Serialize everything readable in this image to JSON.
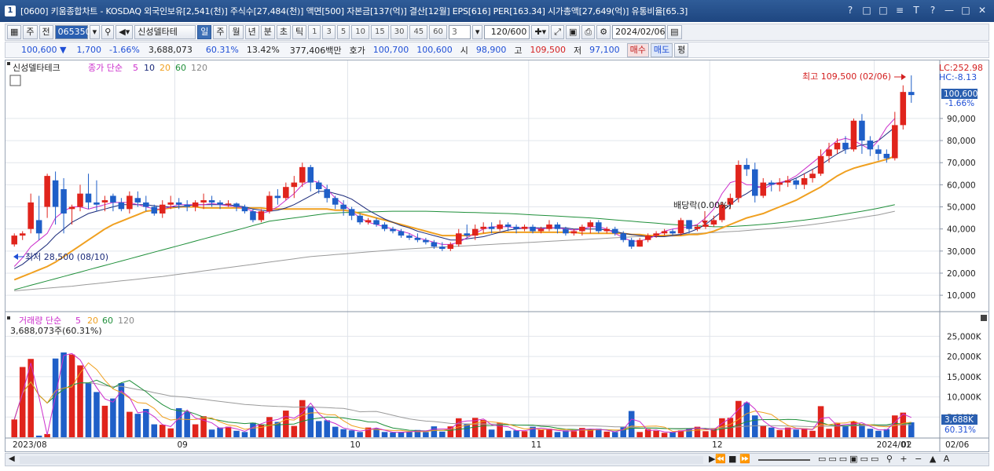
{
  "window": {
    "title": "[0600] 키움종합차트 - KOSDAQ 외국인보유[2,541(천)] 주식수[27,484(천)] 액면[500] 자본금[137(억)] 결산[12월] EPS[616] PER[163.34] 시가총액[27,649(억)] 유통비율[65.3]",
    "badge": "1",
    "buttons": [
      "?",
      "□",
      "□",
      "≡",
      "T",
      "?",
      "—",
      "□",
      "✕"
    ]
  },
  "toolbar": {
    "period_type": "주",
    "prev": "전",
    "code": "065350",
    "name": "신성델타테",
    "periods": [
      "일",
      "주",
      "월",
      "년",
      "분",
      "초",
      "틱"
    ],
    "minutes": [
      "1",
      "3",
      "5",
      "10",
      "15",
      "30",
      "45",
      "60"
    ],
    "custom_min": "3",
    "count": "120/600",
    "date": "2024/02/06"
  },
  "quote": {
    "price": "100,600",
    "arrow": "▼",
    "change": "1,700",
    "rate": "-1.66%",
    "volume": "3,688,073",
    "vol_rate": "60.31%",
    "turnover": "13.42%",
    "amount": "377,406백만",
    "ask_label": "호가",
    "ask": "100,700",
    "bid": "100,600",
    "open_label": "시",
    "open": "98,900",
    "high_label": "고",
    "high": "109,500",
    "low_label": "저",
    "low": "97,100",
    "buy": "매수",
    "sell": "매도",
    "even": "평"
  },
  "price_panel": {
    "name": "신성델타테크",
    "legend_prefix": "종가 단순",
    "mas": [
      "5",
      "10",
      "20",
      "60",
      "120"
    ],
    "ma_colors": [
      "#cc2fcc",
      "#1b2a7a",
      "#f0a020",
      "#1f8f3a",
      "#888888"
    ],
    "lc": "LC:252.98",
    "hc": "HC:-8.13",
    "last": "100,600",
    "last_rate": "-1.66%",
    "max_label": "최고 109,500 (02/06)",
    "min_label": "최저 28,500 (08/10)",
    "div_label": "배당락(0.00%)",
    "y_ticks": [
      "90,000",
      "80,000",
      "70,000",
      "60,000",
      "50,000",
      "40,000",
      "30,000",
      "20,000",
      "10,000"
    ]
  },
  "volume_panel": {
    "legend": "거래량 단순",
    "mas": [
      "5",
      "20",
      "60",
      "120"
    ],
    "cur": "3,688,073주(60.31%)",
    "last": "3,688K",
    "last_rate": "60.31%",
    "y_ticks": [
      "25,000K",
      "20,000K",
      "15,000K",
      "10,000K",
      "5,000K"
    ]
  },
  "x_labels": [
    "2023/08",
    "09",
    "10",
    "11",
    "12",
    "2024/01",
    "02",
    "02/06"
  ],
  "chart_data": {
    "type": "candlestick",
    "y_range": [
      4000,
      112000
    ],
    "vol_range": [
      0,
      28000
    ],
    "candles": [
      [
        33000,
        37000,
        32000,
        38000,
        4400
      ],
      [
        37000,
        38000,
        35000,
        39000,
        17400
      ],
      [
        40000,
        52000,
        38000,
        56000,
        19400
      ],
      [
        44000,
        38000,
        35000,
        55000,
        400
      ],
      [
        50000,
        64000,
        45000,
        65000,
        800
      ],
      [
        62000,
        50000,
        42000,
        66000,
        19500
      ],
      [
        58000,
        47000,
        38000,
        63000,
        21000
      ],
      [
        49000,
        50000,
        42000,
        51000,
        20500
      ],
      [
        50000,
        56000,
        48000,
        60000,
        17800
      ],
      [
        56000,
        52000,
        49000,
        65000,
        13400
      ],
      [
        52000,
        51000,
        48000,
        62000,
        11200
      ],
      [
        52000,
        53000,
        48000,
        55000,
        7800
      ],
      [
        55000,
        52000,
        48000,
        56000,
        9600
      ],
      [
        52000,
        49000,
        48000,
        54000,
        13400
      ],
      [
        49000,
        55000,
        47000,
        57000,
        6300
      ],
      [
        54000,
        52000,
        50000,
        57000,
        5800
      ],
      [
        52000,
        50000,
        48000,
        55000,
        7000
      ],
      [
        50000,
        47000,
        46000,
        51000,
        3200
      ],
      [
        47000,
        51000,
        45000,
        53000,
        3100
      ],
      [
        51000,
        52000,
        49000,
        55000,
        2200
      ],
      [
        52000,
        51000,
        49000,
        54000,
        7200
      ],
      [
        51000,
        50000,
        48000,
        53000,
        6300
      ],
      [
        50000,
        52000,
        48000,
        53000,
        3200
      ],
      [
        52000,
        53000,
        49000,
        56000,
        5200
      ],
      [
        53000,
        52000,
        50000,
        55000,
        1900
      ],
      [
        52000,
        51000,
        49000,
        53000,
        2400
      ],
      [
        51000,
        51500,
        50000,
        53000,
        2600
      ],
      [
        51500,
        50000,
        48000,
        52000,
        1600
      ],
      [
        50000,
        48000,
        47000,
        51000,
        1300
      ],
      [
        48000,
        44000,
        43000,
        49000,
        3600
      ],
      [
        44000,
        48000,
        43000,
        49000,
        3100
      ],
      [
        48000,
        55000,
        47000,
        57000,
        5000
      ],
      [
        55000,
        54000,
        51000,
        58000,
        3800
      ],
      [
        54000,
        59000,
        53000,
        61000,
        6600
      ],
      [
        59000,
        61000,
        54000,
        64000,
        2800
      ],
      [
        61000,
        68000,
        59000,
        70000,
        9200
      ],
      [
        68000,
        61000,
        57000,
        69000,
        7700
      ],
      [
        61000,
        58000,
        56000,
        62000,
        4000
      ],
      [
        58000,
        54000,
        52000,
        60000,
        4200
      ],
      [
        54000,
        51000,
        49000,
        55000,
        2600
      ],
      [
        51000,
        49000,
        46000,
        53000,
        2000
      ],
      [
        49000,
        46000,
        44000,
        50000,
        1700
      ],
      [
        46000,
        43000,
        42000,
        47000,
        1300
      ],
      [
        43000,
        44000,
        42000,
        45000,
        2400
      ],
      [
        44000,
        42000,
        41000,
        45000,
        2200
      ],
      [
        42000,
        40000,
        39000,
        43000,
        1300
      ],
      [
        40000,
        39000,
        38000,
        41000,
        1200
      ],
      [
        39000,
        37000,
        36000,
        40000,
        1300
      ],
      [
        37000,
        36000,
        35000,
        38000,
        1300
      ],
      [
        36000,
        35000,
        34000,
        38000,
        1800
      ],
      [
        35000,
        34000,
        33000,
        36000,
        1300
      ],
      [
        34000,
        32000,
        31000,
        35000,
        2700
      ],
      [
        32000,
        31000,
        30000,
        34000,
        1400
      ],
      [
        31000,
        33000,
        30000,
        34000,
        2700
      ],
      [
        33000,
        38000,
        32000,
        40000,
        4700
      ],
      [
        38000,
        37000,
        36000,
        42000,
        3400
      ],
      [
        37000,
        40000,
        35000,
        42000,
        4800
      ],
      [
        40000,
        41000,
        38000,
        43000,
        4300
      ],
      [
        41000,
        40000,
        38000,
        43000,
        1900
      ],
      [
        40000,
        42000,
        39000,
        44000,
        3600
      ],
      [
        42000,
        41000,
        39000,
        43000,
        1600
      ],
      [
        41000,
        40000,
        38000,
        42000,
        1700
      ],
      [
        40000,
        41000,
        39000,
        42000,
        1500
      ],
      [
        41000,
        39000,
        38000,
        42000,
        2600
      ],
      [
        39000,
        40000,
        38000,
        41000,
        1900
      ],
      [
        40000,
        42000,
        39000,
        44000,
        2100
      ],
      [
        42000,
        40000,
        38000,
        43000,
        1300
      ],
      [
        40000,
        38000,
        37000,
        41000,
        1700
      ],
      [
        38000,
        39000,
        37000,
        40000,
        1500
      ],
      [
        39000,
        41000,
        37000,
        42000,
        2300
      ],
      [
        41000,
        43000,
        38000,
        44000,
        1800
      ],
      [
        43000,
        39000,
        38000,
        44000,
        2100
      ],
      [
        39000,
        40000,
        38000,
        41000,
        1400
      ],
      [
        40000,
        38000,
        37000,
        41000,
        1300
      ],
      [
        38000,
        35000,
        34000,
        39000,
        2500
      ],
      [
        35000,
        32000,
        31000,
        36000,
        6500
      ],
      [
        32000,
        35000,
        32000,
        36000,
        1300
      ],
      [
        35000,
        37000,
        34000,
        38000,
        2000
      ],
      [
        37000,
        38000,
        36000,
        39000,
        1600
      ],
      [
        38000,
        39000,
        37000,
        40000,
        1100
      ],
      [
        39000,
        38000,
        37000,
        40000,
        1300
      ],
      [
        38000,
        44000,
        37000,
        45000,
        1700
      ],
      [
        44000,
        40000,
        38000,
        44000,
        2100
      ],
      [
        40000,
        41000,
        39000,
        42000,
        2600
      ],
      [
        41000,
        42000,
        40000,
        43000,
        1500
      ],
      [
        42000,
        44000,
        41000,
        46000,
        2200
      ],
      [
        44000,
        51000,
        43000,
        52000,
        4700
      ],
      [
        51000,
        54000,
        49000,
        56000,
        4800
      ],
      [
        54000,
        69000,
        52000,
        71000,
        9000
      ],
      [
        69000,
        67000,
        64000,
        72000,
        8600
      ],
      [
        67000,
        55000,
        52000,
        70000,
        5400
      ],
      [
        55000,
        61000,
        54000,
        63000,
        2800
      ],
      [
        61000,
        60000,
        57000,
        62000,
        2400
      ],
      [
        60000,
        61000,
        57000,
        63000,
        1800
      ],
      [
        61000,
        62000,
        59000,
        64000,
        2400
      ],
      [
        62000,
        60000,
        58000,
        63000,
        1900
      ],
      [
        60000,
        63000,
        58000,
        65000,
        2200
      ],
      [
        63000,
        65000,
        61000,
        67000,
        1600
      ],
      [
        65000,
        73000,
        64000,
        76000,
        7700
      ],
      [
        73000,
        76000,
        70000,
        79000,
        2100
      ],
      [
        76000,
        79000,
        74000,
        81000,
        3600
      ],
      [
        79000,
        76000,
        74000,
        82000,
        2700
      ],
      [
        76000,
        89000,
        75000,
        90000,
        3900
      ],
      [
        89000,
        80000,
        74000,
        92000,
        3300
      ],
      [
        80000,
        76000,
        73000,
        82000,
        2100
      ],
      [
        76000,
        74000,
        71000,
        78000,
        1600
      ],
      [
        74000,
        72000,
        70000,
        76000,
        2000
      ],
      [
        72000,
        87000,
        71000,
        93000,
        5400
      ],
      [
        87000,
        102000,
        85000,
        105000,
        6100
      ],
      [
        102000,
        100600,
        97100,
        109500,
        3688
      ]
    ],
    "ma5": [
      23000,
      27000,
      32000,
      35000,
      38000,
      45000,
      48000,
      50000,
      50000,
      49000,
      50000,
      51000,
      52000,
      52000,
      52000,
      51000,
      50000,
      49000,
      49000,
      50000,
      51000,
      51000,
      51000,
      51000,
      51500,
      51000,
      50500,
      50000,
      49500,
      48000,
      47000,
      48000,
      50000,
      53000,
      56000,
      60000,
      62000,
      61000,
      58000,
      54000,
      51000,
      48000,
      45000,
      43000,
      42000,
      41000,
      40000,
      39000,
      38000,
      36000,
      35000,
      34000,
      33000,
      33000,
      34000,
      36000,
      38000,
      40000,
      41000,
      41000,
      41000,
      40500,
      40500,
      40500,
      40000,
      40500,
      40500,
      40000,
      39500,
      40000,
      41000,
      41000,
      40000,
      38000,
      36000,
      34500,
      34500,
      35500,
      37000,
      39000,
      40000,
      40500,
      41000,
      42000,
      45000,
      49000,
      56000,
      61000,
      62000,
      60000,
      60000,
      58000,
      60000,
      61000,
      62000,
      64000,
      67000,
      70000,
      73000,
      77000,
      80000,
      81000,
      80000,
      78000,
      76000,
      80000,
      86000,
      90000
    ],
    "ma10": [
      22000,
      24000,
      27000,
      30000,
      33000,
      37000,
      40000,
      43000,
      45000,
      47000,
      48000,
      49000,
      50000,
      51000,
      51000,
      51000,
      51000,
      50500,
      50000,
      50000,
      50000,
      50500,
      51000,
      51000,
      51000,
      51000,
      51000,
      50500,
      50000,
      49000,
      48500,
      48000,
      48500,
      49500,
      51000,
      53000,
      55000,
      57000,
      57000,
      56000,
      55000,
      53500,
      51000,
      48500,
      46500,
      44500,
      43000,
      41500,
      40500,
      39000,
      38000,
      37000,
      36000,
      35000,
      35000,
      35500,
      36000,
      36500,
      37500,
      38500,
      39500,
      40000,
      40500,
      40500,
      40500,
      40500,
      40500,
      40500,
      40000,
      40000,
      40000,
      40000,
      39500,
      39000,
      38000,
      37500,
      37000,
      36500,
      36500,
      36500,
      37000,
      37500,
      38500,
      40000,
      42000,
      45000,
      48000,
      51000,
      54000,
      56000,
      58500,
      59500,
      60500,
      61000,
      61500,
      63000,
      65000,
      67000,
      69000,
      71500,
      74000,
      76000,
      77000,
      78000,
      78500,
      80000,
      83000,
      86000
    ],
    "ma20": [
      17000,
      18500,
      20000,
      21500,
      23000,
      25000,
      27500,
      30000,
      32500,
      35000,
      37500,
      40000,
      42000,
      43500,
      45000,
      46500,
      48000,
      48500,
      49000,
      49500,
      50000,
      50000,
      50000,
      49500,
      49500,
      49500,
      49500,
      49500,
      49500,
      49500,
      49500,
      49000,
      49000,
      49000,
      49000,
      49000,
      49000,
      49000,
      49000,
      48500,
      48500,
      48000,
      47000,
      46000,
      45000,
      44000,
      43000,
      42000,
      41000,
      40000,
      39000,
      38000,
      37000,
      37000,
      37000,
      37000,
      37500,
      38000,
      38500,
      38500,
      38500,
      38500,
      38500,
      38500,
      38500,
      38500,
      38500,
      38500,
      38500,
      38000,
      38000,
      38000,
      38000,
      38000,
      38000,
      37500,
      37500,
      37000,
      37000,
      37000,
      37000,
      37000,
      37500,
      37500,
      38000,
      39000,
      40500,
      42000,
      43500,
      45000,
      46000,
      47000,
      48500,
      50000,
      51500,
      53000,
      55000,
      57000,
      59000,
      61500,
      64000,
      66000,
      67500,
      68500,
      69500,
      70500,
      71500,
      73000
    ],
    "ma60": [
      12500,
      13500,
      14500,
      15500,
      16500,
      17500,
      18500,
      19500,
      20500,
      21500,
      22500,
      23500,
      24500,
      25500,
      26500,
      27500,
      28500,
      29500,
      30500,
      31500,
      32500,
      33500,
      34500,
      35500,
      36500,
      37500,
      38500,
      39500,
      40500,
      41500,
      42500,
      43500,
      44000,
      44500,
      45000,
      45500,
      46000,
      46500,
      47000,
      47200,
      47400,
      47500,
      47600,
      47700,
      47800,
      47900,
      48000,
      48000,
      48000,
      48000,
      48000,
      47900,
      47800,
      47700,
      47600,
      47500,
      47400,
      47300,
      47200,
      47100,
      47000,
      46800,
      46600,
      46400,
      46200,
      46000,
      45800,
      45600,
      45400,
      45200,
      45000,
      44700,
      44400,
      44100,
      43800,
      43500,
      43200,
      42900,
      42600,
      42300,
      42000,
      41800,
      41600,
      41400,
      41200,
      41000,
      41000,
      41100,
      41300,
      41500,
      41800,
      42100,
      42400,
      42800,
      43200,
      43600,
      44000,
      44500,
      45000,
      45600,
      46200,
      46800,
      47400,
      48000,
      48700,
      49400,
      50200,
      51000
    ],
    "ma120": [
      12000,
      12300,
      12600,
      12900,
      13200,
      13500,
      13800,
      14100,
      14500,
      14900,
      15300,
      15700,
      16100,
      16500,
      16900,
      17300,
      17700,
      18100,
      18500,
      19000,
      19500,
      20000,
      20500,
      21000,
      21500,
      22000,
      22500,
      23000,
      23500,
      24000,
      24500,
      25000,
      25500,
      26000,
      26500,
      27000,
      27500,
      27800,
      28100,
      28400,
      28700,
      29000,
      29300,
      29600,
      29900,
      30200,
      30500,
      30800,
      31000,
      31200,
      31400,
      31600,
      31800,
      32000,
      32200,
      32400,
      32600,
      32800,
      33000,
      33200,
      33400,
      33600,
      33800,
      34000,
      34200,
      34400,
      34600,
      34800,
      35000,
      35200,
      35400,
      35600,
      35800,
      36000,
      36200,
      36400,
      36600,
      36800,
      37000,
      37200,
      37400,
      37600,
      37800,
      38000,
      38200,
      38400,
      38600,
      38800,
      39000,
      39300,
      39600,
      39900,
      40200,
      40500,
      40800,
      41200,
      41600,
      42000,
      42500,
      43000,
      43500,
      44000,
      44600,
      45200,
      45800,
      46400,
      47200,
      48000
    ]
  }
}
